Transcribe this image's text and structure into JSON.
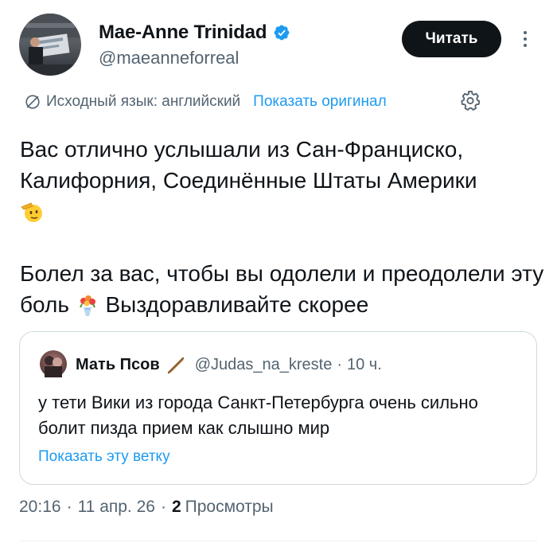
{
  "author": {
    "name": "Mae-Anne Trinidad",
    "handle": "@maeanneforreal",
    "verified": true,
    "verified_color": "#1d9bf0"
  },
  "follow_button": {
    "label": "Читать"
  },
  "more_icon": "more-vertical-icon",
  "translation": {
    "icon": "translate-icon",
    "source_language": "Исходный язык: английский",
    "show_original": "Показать оригинал",
    "settings_icon": "gear-icon"
  },
  "tweet": {
    "paragraph1": "Вас отлично услышали из Сан-Франциско, Калифорния, Соединённые Штаты Америки",
    "emoji1": "saluting-face-emoji",
    "paragraph2_part1": "Болел за вас, чтобы вы одолели и преодолели эту боль",
    "emoji2": "bouquet-emoji",
    "paragraph2_part2": "Выздоравливайте скорее"
  },
  "quote": {
    "name": "Мать Псов",
    "name_emoji": "stick-emoji",
    "handle": "@Judas_na_kreste",
    "separator": "·",
    "time": "10 ч.",
    "text": "у тети Вики из города Санкт-Петербурга очень сильно болит пизда прием как слышно мир",
    "show_thread": "Показать эту ветку"
  },
  "meta": {
    "time": "20:16",
    "dot1": "·",
    "date": "11 апр. 26",
    "dot2": "·",
    "views_count": "2",
    "views_label": "Просмотры"
  },
  "colors": {
    "text_primary": "#0f1419",
    "text_secondary": "#536471",
    "link": "#1d9bf0",
    "border": "#cfd9de"
  }
}
